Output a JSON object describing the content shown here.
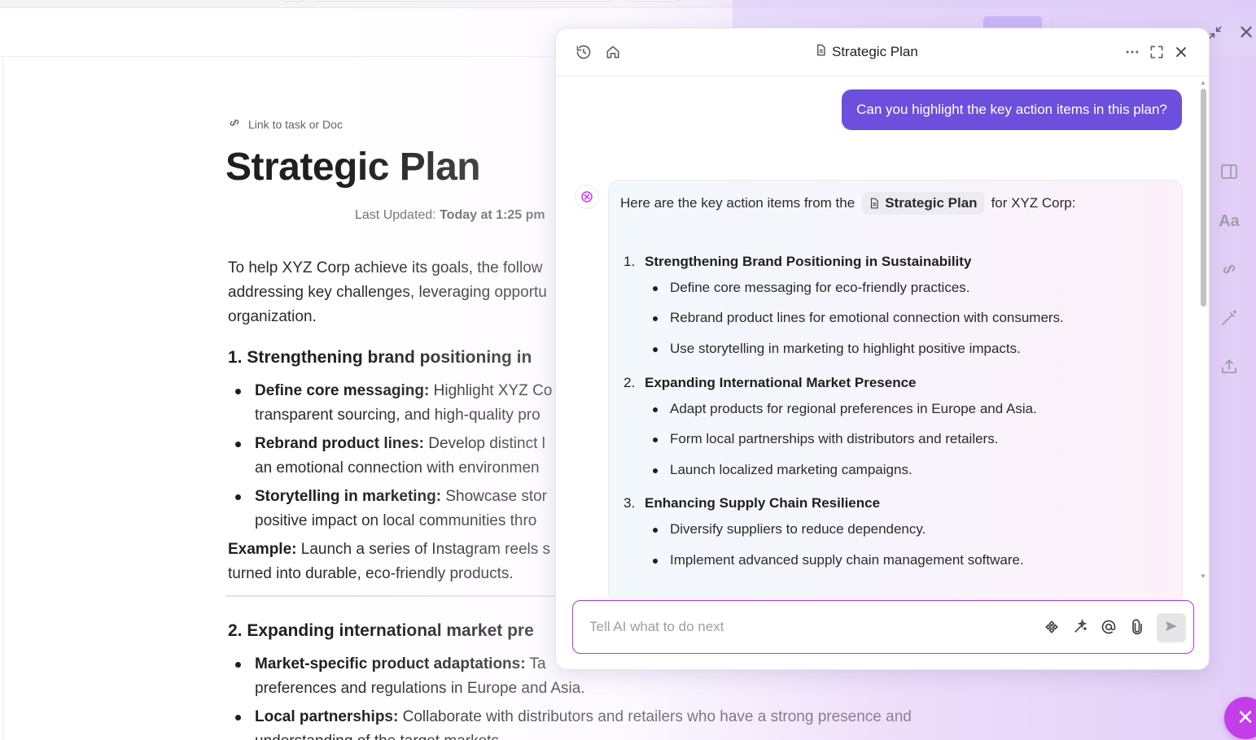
{
  "doc": {
    "link_task": "Link to task or Doc",
    "title": "Strategic Plan",
    "last_updated_label": "Last Updated:",
    "last_updated_value": "Today at 1:25 pm",
    "intro_line1": "To help XYZ Corp achieve its goals, the follow",
    "intro_line2": "addressing key challenges, leveraging opportu",
    "intro_line3": "organization.",
    "section1_heading": "1. Strengthening brand positioning in",
    "section1_bullets": [
      {
        "bold": "Define core messaging:",
        "line1": " Highlight XYZ Co",
        "line2": "transparent sourcing, and high-quality pro"
      },
      {
        "bold": "Rebrand product lines:",
        "line1": " Develop distinct l",
        "line2": "an emotional connection with environmen"
      },
      {
        "bold": "Storytelling in marketing:",
        "line1": " Showcase stor",
        "line2": "positive impact on local communities thro"
      }
    ],
    "example_bold": "Example:",
    "example_line1": " Launch a series of Instagram reels s",
    "example_line2": "turned into durable, eco-friendly products.",
    "section2_heading": "2. Expanding international market pre",
    "section2_bullets": [
      {
        "bold": "Market-specific product adaptations:",
        "line1": " Ta",
        "line2": "preferences and regulations in Europe and Asia."
      },
      {
        "bold": "Local partnerships:",
        "line1": " Collaborate with distributors and retailers who have a strong presence and",
        "line2": "understanding of the target markets."
      }
    ]
  },
  "panel": {
    "title": "Strategic Plan",
    "user_message": "Can you highlight the key action items in this plan?",
    "ai_intro_before": "Here are the key action items from the",
    "ai_chip": "Strategic Plan",
    "ai_intro_after": "for XYZ Corp:",
    "items": [
      {
        "num": "1.",
        "title": "Strengthening Brand Positioning in Sustainability",
        "bullets": [
          "Define core messaging for eco-friendly practices.",
          "Rebrand product lines for emotional connection with consumers.",
          "Use storytelling in marketing to highlight positive impacts."
        ]
      },
      {
        "num": "2.",
        "title": "Expanding International Market Presence",
        "bullets": [
          "Adapt products for regional preferences in Europe and Asia.",
          "Form local partnerships with distributors and retailers.",
          "Launch localized marketing campaigns."
        ]
      },
      {
        "num": "3.",
        "title": "Enhancing Supply Chain Resilience",
        "bullets": [
          "Diversify suppliers to reduce dependency.",
          "Implement advanced supply chain management software."
        ]
      }
    ],
    "input_placeholder": "Tell AI what to do next"
  },
  "rail": {
    "font_label": "Aa"
  },
  "colors": {
    "accent": "#6c4fdc",
    "brand_magenta": "#c43ee8",
    "input_border": "#b23bd6"
  },
  "icons": [
    "history-icon",
    "home-icon",
    "doc-icon",
    "more-icon",
    "expand-icon",
    "close-icon",
    "link-icon",
    "ai-logo-icon",
    "brain-icon",
    "sparkle-icon",
    "at-icon",
    "attach-icon",
    "send-icon",
    "sidebar-icon",
    "upload-icon",
    "magic-wand-icon"
  ]
}
